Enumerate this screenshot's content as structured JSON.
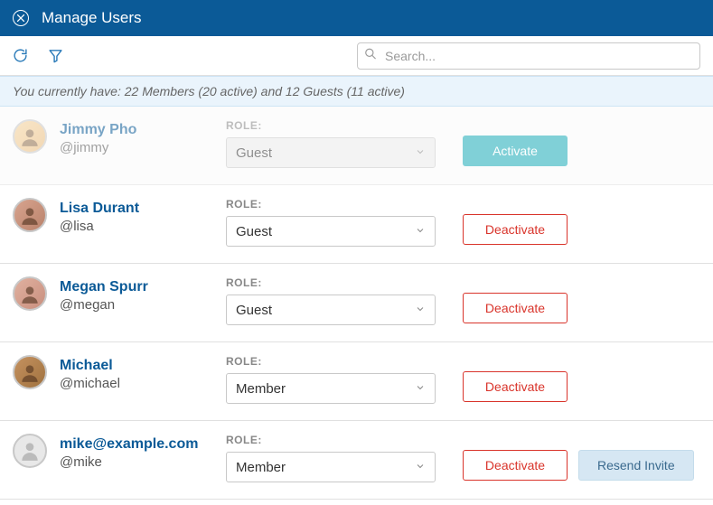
{
  "header": {
    "title": "Manage Users"
  },
  "toolbar": {
    "search_placeholder": "Search..."
  },
  "summary": {
    "text": "You currently have: 22 Members (20 active) and 12 Guests (11 active)"
  },
  "role_label": "ROLE:",
  "buttons": {
    "activate": "Activate",
    "deactivate": "Deactivate",
    "resend_invite": "Resend Invite"
  },
  "users": [
    {
      "name": "Jimmy Pho",
      "handle": "@jimmy",
      "role": "Guest",
      "status": "inactive",
      "avatar_variant": "c1",
      "has_resend": false
    },
    {
      "name": "Lisa Durant",
      "handle": "@lisa",
      "role": "Guest",
      "status": "active",
      "avatar_variant": "c2",
      "has_resend": false
    },
    {
      "name": "Megan Spurr",
      "handle": "@megan",
      "role": "Guest",
      "status": "active",
      "avatar_variant": "c3",
      "has_resend": false
    },
    {
      "name": "Michael",
      "handle": "@michael",
      "role": "Member",
      "status": "active",
      "avatar_variant": "c4",
      "has_resend": false
    },
    {
      "name": "mike@example.com",
      "handle": "@mike",
      "role": "Member",
      "status": "active",
      "avatar_variant": "placeholder",
      "has_resend": true
    }
  ]
}
